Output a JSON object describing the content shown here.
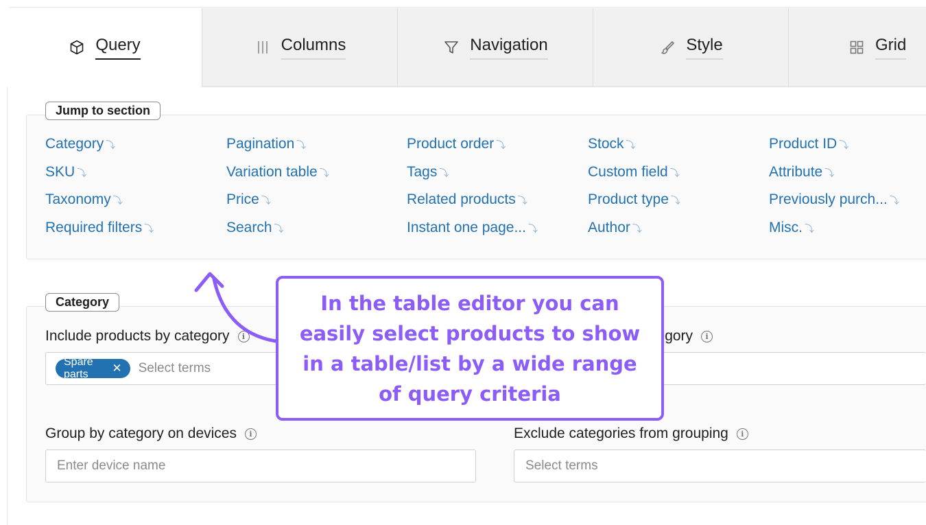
{
  "tabs": [
    {
      "label": "Query",
      "icon": "cube-icon",
      "active": true
    },
    {
      "label": "Columns",
      "icon": "columns-icon",
      "active": false
    },
    {
      "label": "Navigation",
      "icon": "filter-icon",
      "active": false
    },
    {
      "label": "Style",
      "icon": "brush-icon",
      "active": false
    },
    {
      "label": "Grid",
      "icon": "grid-icon",
      "active": false
    }
  ],
  "jump": {
    "title": "Jump to section",
    "link_arrow": "⤵",
    "links": [
      [
        "Category",
        "SKU",
        "Taxonomy",
        "Required filters"
      ],
      [
        "Pagination",
        "Variation table",
        "Price",
        "Search"
      ],
      [
        "Product order",
        "Tags",
        "Related products",
        "Instant one page..."
      ],
      [
        "Stock",
        "Custom field",
        "Product type",
        "Author"
      ],
      [
        "Product ID",
        "Attribute",
        "Previously purch...",
        "Misc."
      ]
    ]
  },
  "category": {
    "title": "Category",
    "include_label": "Include products by category",
    "include_chip": "Spare parts",
    "include_chip_remove": "✕",
    "include_placeholder": "Select terms",
    "exclude_label_fragment": "ategory",
    "group_label": "Group by category on devices",
    "group_placeholder": "Enter device name",
    "exclude_group_label": "Exclude categories from grouping",
    "exclude_group_placeholder": "Select terms",
    "info_glyph": "i"
  },
  "callout": {
    "text": "In the table editor you can easily select products to show in a table/list by a wide range of query criteria"
  },
  "colors": {
    "link": "#2271b1",
    "accent_purple": "#8b5cf6",
    "chip": "#2271b1"
  }
}
